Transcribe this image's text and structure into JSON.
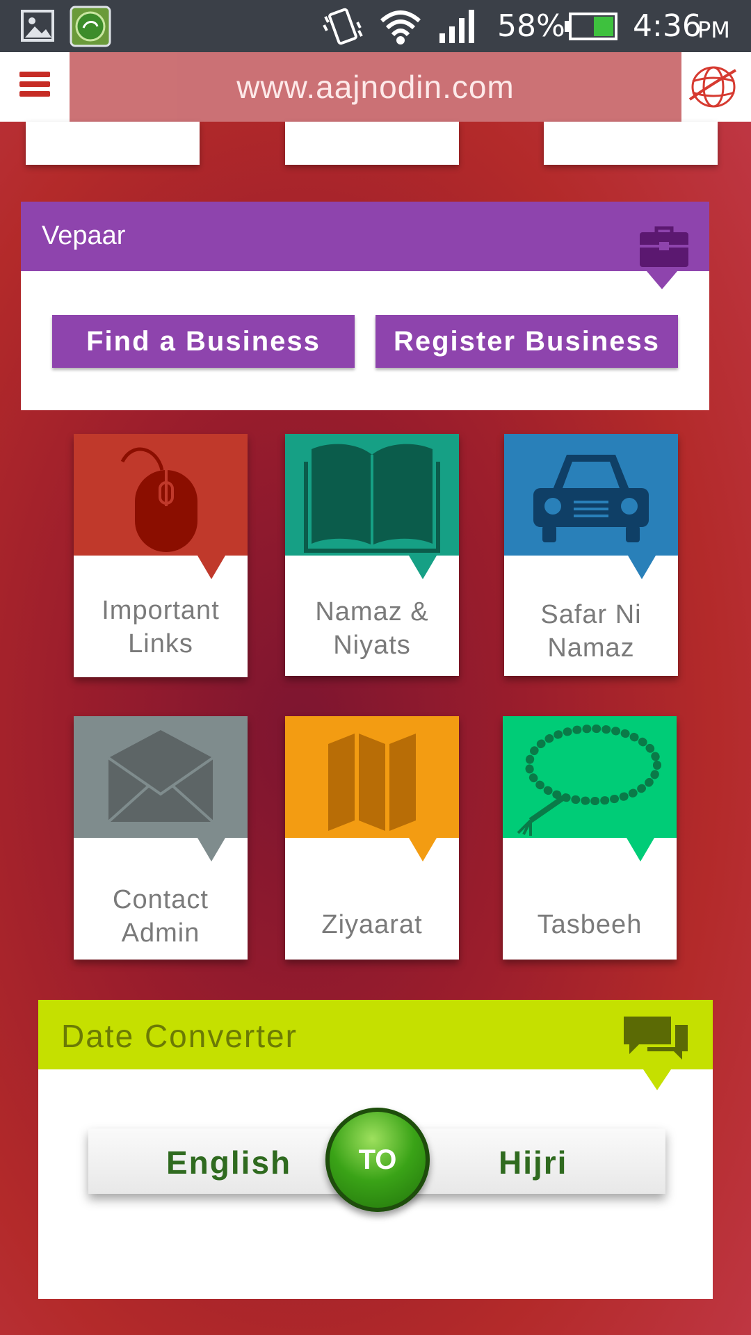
{
  "status_bar": {
    "battery": "58%",
    "time": "4:36",
    "ampm": "PM",
    "icons": [
      "gallery-icon",
      "app-notification-icon",
      "vibrate-icon",
      "wifi-icon",
      "signal-icon",
      "battery-icon"
    ]
  },
  "header": {
    "url": "www.aajnodin.com",
    "icons": [
      "hamburger-menu-icon",
      "globe-logo-icon"
    ]
  },
  "vepaar": {
    "title": "Vepaar",
    "icon": "briefcase-icon",
    "accent": "#8e44ad",
    "find_label": "Find a Business",
    "register_label": "Register Business"
  },
  "tiles": [
    {
      "line1": "Important",
      "line2": "Links",
      "color": "#c0392b",
      "icon": "mouse-icon"
    },
    {
      "line1": "Namaz &",
      "line2": "Niyats",
      "color": "#16a085",
      "icon": "book-icon"
    },
    {
      "line1": "Safar Ni",
      "line2": "Namaz",
      "color": "#2980b9",
      "icon": "car-icon"
    },
    {
      "line1": "Contact",
      "line2": "Admin",
      "color": "#7f8c8d",
      "icon": "envelope-icon"
    },
    {
      "line1": "Ziyaarat",
      "line2": "",
      "color": "#f39c12",
      "icon": "map-icon"
    },
    {
      "line1": "Tasbeeh",
      "line2": "",
      "color": "#00cc77",
      "icon": "tasbeeh-beads-icon"
    }
  ],
  "date_converter": {
    "title": "Date Converter",
    "icon": "chat-bubbles-icon",
    "accent": "#c5e000",
    "from": "English",
    "to_button": "TO",
    "to": "Hijri"
  }
}
